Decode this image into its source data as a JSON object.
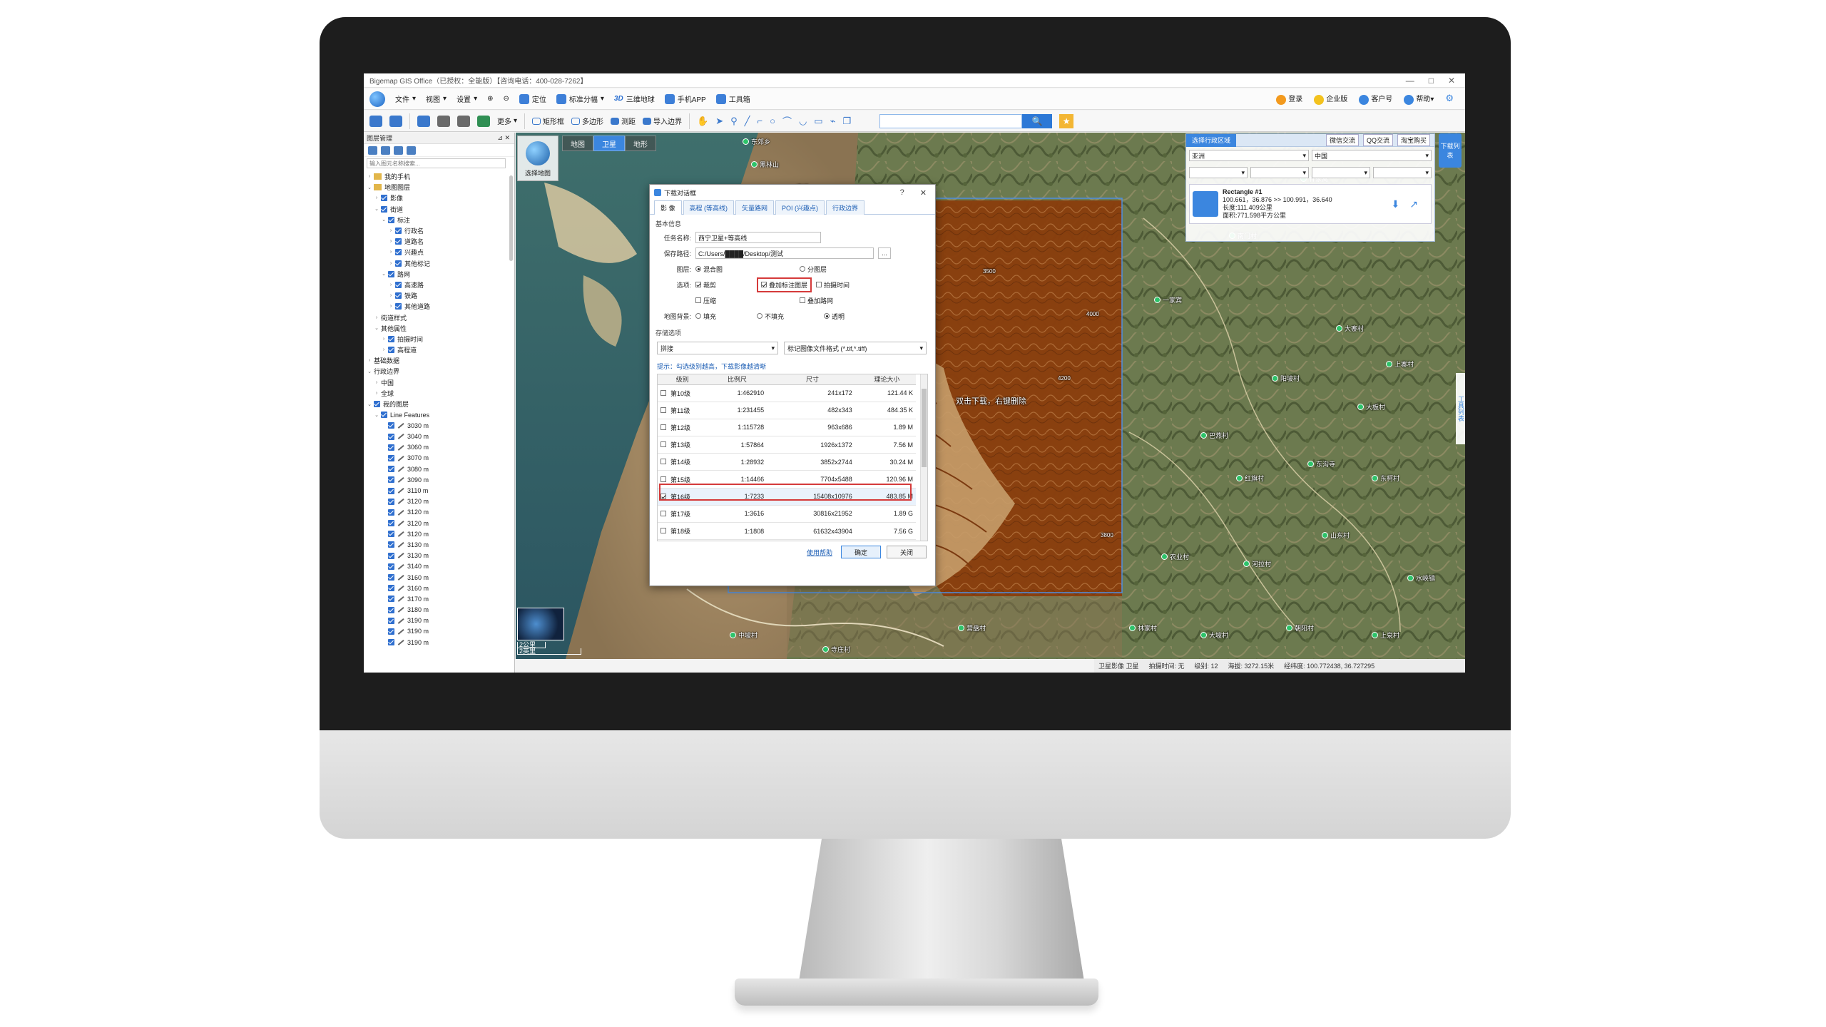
{
  "window": {
    "title": "Bigemap GIS Office（已授权：全能版）【咨询电话：400-028-7262】",
    "controls": [
      "—",
      "□",
      "✕"
    ]
  },
  "menu": {
    "items": [
      "文件",
      "视图",
      "设置",
      "定位",
      "标准分幅",
      "三维地球",
      "手机APP",
      "工具箱"
    ],
    "three_d": "3D",
    "right": [
      "登录",
      "企业版",
      "客户号",
      "帮助"
    ]
  },
  "toolbar": {
    "more": "更多",
    "buttons": [
      "矩形框",
      "多边形",
      "测距",
      "导入边界"
    ],
    "search_placeholder": "",
    "search_btn": "🔍",
    "star_btn": "★"
  },
  "layer_panel": {
    "title": "图层管理",
    "search_placeholder": "输入图元名称搜索...",
    "tree": [
      {
        "label": "我的手机",
        "level": 1,
        "type": "folder"
      },
      {
        "label": "地图图层",
        "level": 1,
        "type": "folder",
        "open": true
      },
      {
        "label": "影像",
        "level": 2,
        "type": "check"
      },
      {
        "label": "街道",
        "level": 2,
        "type": "check",
        "open": true
      },
      {
        "label": "标注",
        "level": 3,
        "type": "check",
        "open": true
      },
      {
        "label": "行政名",
        "level": 4,
        "type": "check"
      },
      {
        "label": "道路名",
        "level": 4,
        "type": "check"
      },
      {
        "label": "兴趣点",
        "level": 4,
        "type": "check"
      },
      {
        "label": "其他标记",
        "level": 4,
        "type": "check"
      },
      {
        "label": "路网",
        "level": 3,
        "type": "check",
        "open": true
      },
      {
        "label": "高速路",
        "level": 4,
        "type": "check"
      },
      {
        "label": "铁路",
        "level": 4,
        "type": "check"
      },
      {
        "label": "其他道路",
        "level": 4,
        "type": "check"
      },
      {
        "label": "街道样式",
        "level": 2,
        "type": "text"
      },
      {
        "label": "其他属性",
        "level": 2,
        "type": "text",
        "open": true
      },
      {
        "label": "拍摄时间",
        "level": 3,
        "type": "check"
      },
      {
        "label": "高程道",
        "level": 3,
        "type": "check"
      },
      {
        "label": "基础数据",
        "level": 1,
        "type": "text"
      },
      {
        "label": "行政边界",
        "level": 1,
        "type": "text",
        "open": true
      },
      {
        "label": "中国",
        "level": 2,
        "type": "text"
      },
      {
        "label": "全球",
        "level": 2,
        "type": "text"
      },
      {
        "label": "我的图层",
        "level": 1,
        "type": "check",
        "open": true
      },
      {
        "label": "Line Features",
        "level": 2,
        "type": "check",
        "open": true
      },
      {
        "label": "3030 m",
        "level": 3,
        "type": "line"
      },
      {
        "label": "3040 m",
        "level": 3,
        "type": "line"
      },
      {
        "label": "3060 m",
        "level": 3,
        "type": "line"
      },
      {
        "label": "3070 m",
        "level": 3,
        "type": "line"
      },
      {
        "label": "3080 m",
        "level": 3,
        "type": "line"
      },
      {
        "label": "3090 m",
        "level": 3,
        "type": "line"
      },
      {
        "label": "3110 m",
        "level": 3,
        "type": "line"
      },
      {
        "label": "3120 m",
        "level": 3,
        "type": "line"
      },
      {
        "label": "3120 m",
        "level": 3,
        "type": "line"
      },
      {
        "label": "3120 m",
        "level": 3,
        "type": "line"
      },
      {
        "label": "3120 m",
        "level": 3,
        "type": "line"
      },
      {
        "label": "3130 m",
        "level": 3,
        "type": "line"
      },
      {
        "label": "3130 m",
        "level": 3,
        "type": "line"
      },
      {
        "label": "3140 m",
        "level": 3,
        "type": "line"
      },
      {
        "label": "3160 m",
        "level": 3,
        "type": "line"
      },
      {
        "label": "3160 m",
        "level": 3,
        "type": "line"
      },
      {
        "label": "3170 m",
        "level": 3,
        "type": "line"
      },
      {
        "label": "3180 m",
        "level": 3,
        "type": "line"
      },
      {
        "label": "3190 m",
        "level": 3,
        "type": "line"
      },
      {
        "label": "3190 m",
        "level": 3,
        "type": "line"
      },
      {
        "label": "3190 m",
        "level": 3,
        "type": "line"
      }
    ]
  },
  "map": {
    "tabs": [
      "地图",
      "卫星",
      "地形"
    ],
    "active_tab": "卫星",
    "select_map": "选择地图",
    "overlay_text": "双击下载，右键删除",
    "scale": [
      "2公里",
      "2英里"
    ],
    "contour_labels": [
      "3500",
      "4000",
      "4200",
      "3800"
    ]
  },
  "region_panel": {
    "title": "选择行政区域",
    "links": [
      "微信交流",
      "QQ交流",
      "淘宝购买"
    ],
    "continent": "亚洲",
    "country": "中国",
    "rect_title": "Rectangle #1",
    "rect_coords": "100.661，36.876 >> 100.991，36.640",
    "rect_perimeter": "长度:111.409公里",
    "rect_area": "面积:771.598平方公里",
    "download_list_btn": "下载列表",
    "tool_list": "工具列表"
  },
  "dialog": {
    "title": "下载对话框",
    "controls": [
      "?",
      "✕"
    ],
    "tabs": [
      "影 像",
      "高程 (等高线)",
      "矢量路网",
      "POI (兴趣点)",
      "行政边界"
    ],
    "section_basic": "基本信息",
    "task_name_label": "任务名称:",
    "task_name": "西宁卫星+等高线",
    "save_path_label": "保存路径:",
    "save_path": "C:/Users/████/Desktop/测试",
    "browse": "...",
    "layer_label": "图层:",
    "layer_opts": [
      "混合图",
      "分图层"
    ],
    "options_label": "选项:",
    "opt_crop": "裁剪",
    "opt_overlay": "叠加标注图层",
    "opt_shot_time": "拍摄时间",
    "opt_compress": "压缩",
    "opt_roadnet": "叠加路网",
    "bg_label": "地图背景:",
    "bg_opts": [
      "填充",
      "不填充",
      "透明"
    ],
    "section_storage": "存储选项",
    "storage_mode": "拼接",
    "storage_format": "标记图像文件格式 (*.tif,*.tiff)",
    "hint": "提示：勾选级别越高，下载影像越清晰",
    "table_headers": [
      "级别",
      "比例尺",
      "尺寸",
      "理论大小"
    ],
    "rows": [
      {
        "level": "第10级",
        "scale": "1:462910",
        "size": "241x172",
        "est": "121.44 K",
        "checked": false
      },
      {
        "level": "第11级",
        "scale": "1:231455",
        "size": "482x343",
        "est": "484.35 K",
        "checked": false
      },
      {
        "level": "第12级",
        "scale": "1:115728",
        "size": "963x686",
        "est": "1.89 M",
        "checked": false
      },
      {
        "level": "第13级",
        "scale": "1:57864",
        "size": "1926x1372",
        "est": "7.56 M",
        "checked": false
      },
      {
        "level": "第14级",
        "scale": "1:28932",
        "size": "3852x2744",
        "est": "30.24 M",
        "checked": false
      },
      {
        "level": "第15级",
        "scale": "1:14466",
        "size": "7704x5488",
        "est": "120.96 M",
        "checked": false
      },
      {
        "level": "第16级",
        "scale": "1:7233",
        "size": "15408x10976",
        "est": "483.85 M",
        "checked": true
      },
      {
        "level": "第17级",
        "scale": "1:3616",
        "size": "30816x21952",
        "est": "1.89 G",
        "checked": false
      },
      {
        "level": "第18级",
        "scale": "1:1808",
        "size": "61632x43904",
        "est": "7.56 G",
        "checked": false
      }
    ],
    "help_link": "使用帮助",
    "ok": "确定",
    "close": "关闭"
  },
  "statusbar": {
    "map_source": "卫星影像 卫星",
    "shot_time": "拍摄时间: 无",
    "level": "级别: 12",
    "altitude": "海拔: 3272.15米",
    "coords": "经纬度: 100.772438, 36.727295"
  },
  "poi_labels": [
    "东郊乡",
    "黑林山",
    "一座道",
    "一家宾",
    "大石湾",
    "土地公",
    "甘家窝",
    "南门村",
    "大寨村",
    "上寨村",
    "大板村",
    "阳坡村",
    "巴燕村",
    "红旗村",
    "东沟寺",
    "东柯村",
    "农业村",
    "河拉村",
    "山东村",
    "水峡镇",
    "林家村",
    "大坡村",
    "朝阳村",
    "上泉村",
    "中坡村",
    "寺庄村",
    "营盘村"
  ],
  "colors": {
    "accent": "#3b86df",
    "contour": "#8a3d0c",
    "highlight": "#d53a3a"
  }
}
